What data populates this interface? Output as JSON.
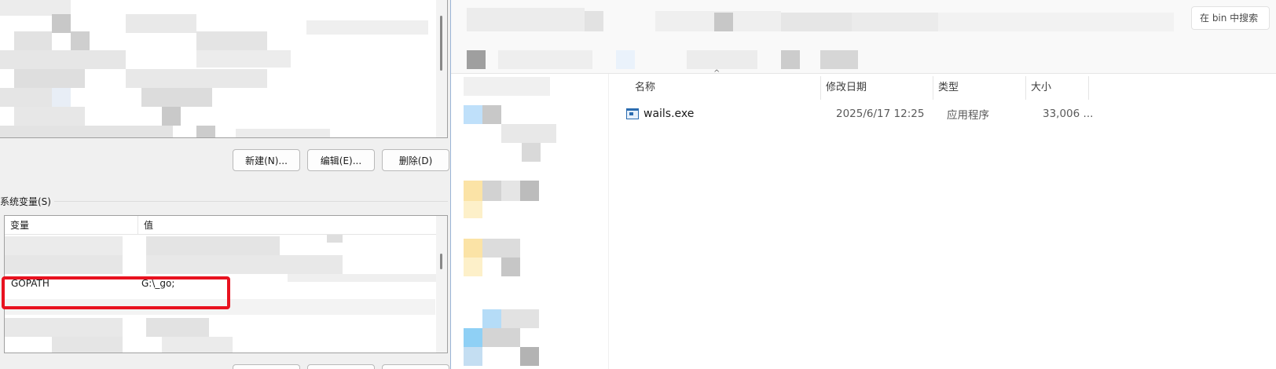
{
  "env_dialog": {
    "buttons": {
      "new_label": "新建(N)...",
      "edit_label": "编辑(E)...",
      "delete_label": "删除(D)"
    },
    "system_group_label": "系统变量(S)",
    "columns": {
      "variable": "变量",
      "value": "值"
    },
    "rows": [
      {
        "variable": "GOPATH",
        "value": "G:\\_go;"
      }
    ],
    "highlight_color": "#e8121f"
  },
  "explorer": {
    "search_placeholder": "在 bin 中搜索",
    "columns": {
      "name": "名称",
      "date": "修改日期",
      "type": "类型",
      "size": "大小"
    },
    "files": [
      {
        "name": "wails.exe",
        "date": "2025/6/17 12:25",
        "type": "应用程序",
        "size": "33,006 ..."
      }
    ]
  }
}
